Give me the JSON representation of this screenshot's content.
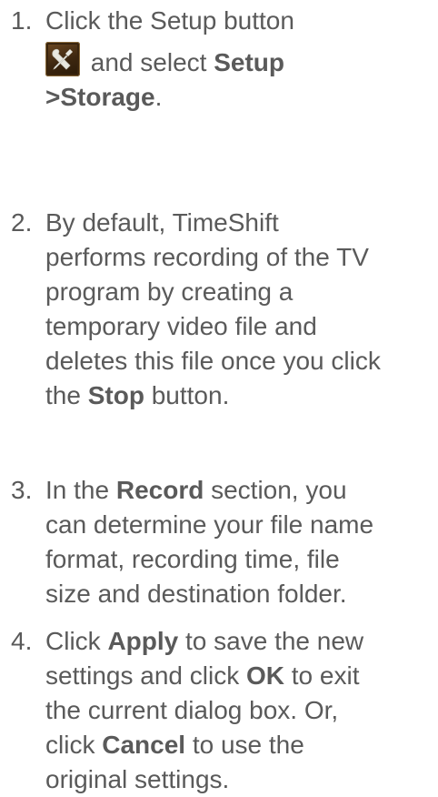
{
  "steps": [
    {
      "number": "1.",
      "text_1": "Click the Setup button",
      "text_2": "and select",
      "bold_1": "Setup",
      "bold_2": ">Storage",
      "text_3": ".",
      "icon": "setup-tools-icon"
    },
    {
      "number": "2.",
      "line_1": "By default, TimeShift",
      "line_2": "performs recording of the TV",
      "line_3": "program by creating a",
      "line_4": "temporary video file and",
      "line_5": "deletes this file once you click",
      "line_6_pre": "the",
      "line_6_bold": "Stop",
      "line_6_post": "button."
    },
    {
      "number": "3.",
      "line_1_pre": "In the",
      "line_1_bold": "Record",
      "line_1_post": "section, you",
      "line_2": "can determine your file name",
      "line_3": "format, recording time, file",
      "line_4": "size and destination folder."
    },
    {
      "number": "4.",
      "line_1_pre": "Click",
      "line_1_bold": "Apply",
      "line_1_post": "to save the new",
      "line_2_pre": "settings and click",
      "line_2_bold": "OK",
      "line_2_post": "to exit",
      "line_3": "the current dialog box. Or,",
      "line_4_pre": "click",
      "line_4_bold": "Cancel",
      "line_4_post": "to use the",
      "line_5": "original settings."
    }
  ],
  "colors": {
    "text": "#5a5a5a",
    "background": "#ffffff",
    "icon_bg": "#4a3016",
    "icon_glyph": "#e8e8e0"
  }
}
